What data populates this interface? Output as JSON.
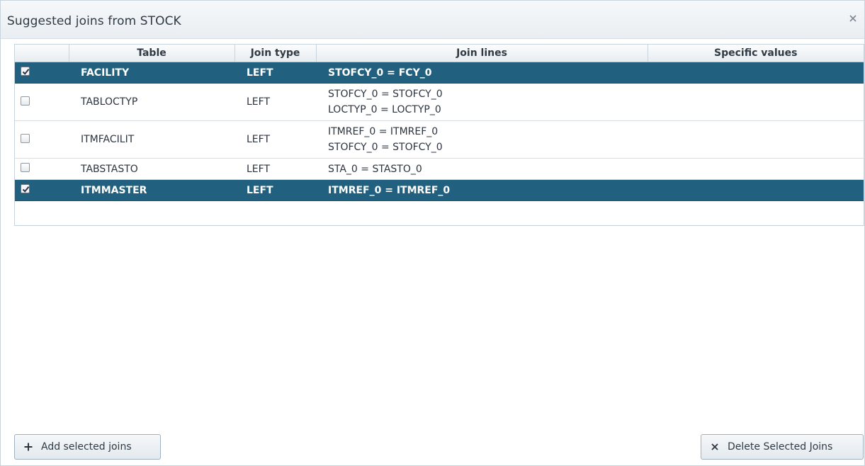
{
  "dialog": {
    "title": "Suggested joins from STOCK",
    "close_icon": "close-icon"
  },
  "grid": {
    "columns": [
      "",
      "Table",
      "Join type",
      "Join lines",
      "Specific values"
    ],
    "rows": [
      {
        "checked": true,
        "selected": true,
        "table": "FACILITY",
        "join_type": "LEFT",
        "join_lines": [
          "STOFCY_0 = FCY_0"
        ],
        "specific_values": ""
      },
      {
        "checked": false,
        "selected": false,
        "table": "TABLOCTYP",
        "join_type": "LEFT",
        "join_lines": [
          "STOFCY_0 = STOFCY_0",
          "LOCTYP_0 = LOCTYP_0"
        ],
        "specific_values": ""
      },
      {
        "checked": false,
        "selected": false,
        "table": "ITMFACILIT",
        "join_type": "LEFT",
        "join_lines": [
          "ITMREF_0 = ITMREF_0",
          "STOFCY_0 = STOFCY_0"
        ],
        "specific_values": ""
      },
      {
        "checked": false,
        "selected": false,
        "table": "TABSTASTO",
        "join_type": "LEFT",
        "join_lines": [
          "STA_0 = STASTO_0"
        ],
        "specific_values": ""
      },
      {
        "checked": true,
        "selected": true,
        "table": "ITMMASTER",
        "join_type": "LEFT",
        "join_lines": [
          "ITMREF_0 = ITMREF_0"
        ],
        "specific_values": ""
      }
    ]
  },
  "buttons": {
    "add_label": "Add selected joins",
    "add_icon": "plus-icon",
    "delete_label": "Delete Selected Joins",
    "delete_icon": "x-icon"
  },
  "colors": {
    "selected_row": "#21607e",
    "header_bg": "#e8edf1"
  }
}
